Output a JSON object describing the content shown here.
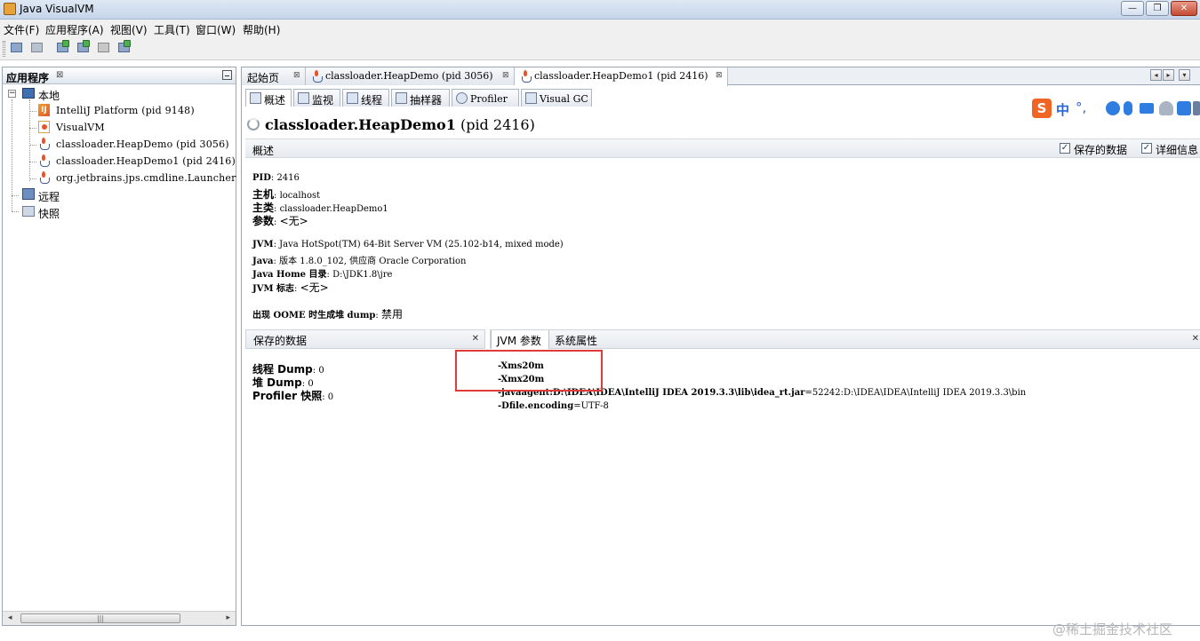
{
  "window": {
    "title": "Java VisualVM",
    "min_glyph": "—",
    "max_glyph": "❐",
    "close_glyph": "✕"
  },
  "menu": [
    "文件(F)",
    "应用程序(A)",
    "视图(V)",
    "工具(T)",
    "窗口(W)",
    "帮助(H)"
  ],
  "left_panel": {
    "title": "应用程序",
    "close_glyph": "⊠",
    "tree": {
      "local": "本地",
      "local_children": [
        "IntelliJ Platform (pid 9148)",
        "VisualVM",
        "classloader.HeapDemo (pid 3056)",
        "classloader.HeapDemo1 (pid 2416)",
        "org.jetbrains.jps.cmdline.Launcher"
      ],
      "remote": "远程",
      "snapshots": "快照"
    },
    "scroll_arrow_left": "◂",
    "scroll_arrow_right": "▸",
    "scroll_grip": "|||"
  },
  "doc_tabs": [
    {
      "label": "起始页"
    },
    {
      "label": "classloader.HeapDemo (pid 3056)"
    },
    {
      "label": "classloader.HeapDemo1 (pid 2416)"
    }
  ],
  "doc_tab_close_glyph": "⊠",
  "doc_nav": {
    "left": "◂",
    "right": "▸",
    "menu": "▾",
    "restore": "▭"
  },
  "sub_tabs": [
    "概述",
    "监视",
    "线程",
    "抽样器",
    "Profiler",
    "Visual GC"
  ],
  "app_title": {
    "name": "classloader.HeapDemo1",
    "pid": "(pid 2416)"
  },
  "overview": {
    "section_title": "概述",
    "checkbox_saved": {
      "label": "保存的数据",
      "checked": true,
      "glyph": "✓"
    },
    "checkbox_details": {
      "label": "详细信息",
      "checked": true,
      "glyph": "✓"
    },
    "pid_key": "PID",
    "pid_value": "2416",
    "host_key": "主机",
    "host_value": "localhost",
    "mainclass_key": "主类",
    "mainclass_value": "classloader.HeapDemo1",
    "args_key": "参数",
    "args_value": "<无>",
    "jvm_key": "JVM",
    "jvm_value": "Java HotSpot(TM) 64-Bit Server VM (25.102-b14, mixed mode)",
    "java_key": "Java",
    "java_value": "版本 1.8.0_102, 供应商 Oracle Corporation",
    "javahome_key": "Java Home 目录",
    "javahome_value": "D:\\JDK1.8\\jre",
    "jvmflags_key": "JVM 标志",
    "jvmflags_value": "<无>",
    "oome_key": "出现 OOME 时生成堆 dump",
    "oome_value": "禁用",
    "sep": ": "
  },
  "saved_data": {
    "title": "保存的数据",
    "close_glyph": "✕",
    "thread_dump_key": "线程 Dump",
    "thread_dump_value": "0",
    "heap_dump_key": "堆 Dump",
    "heap_dump_value": "0",
    "profiler_key": "Profiler 快照",
    "profiler_value": "0"
  },
  "jvm_tabs": {
    "active": "JVM 参数",
    "other": "系统属性",
    "close_glyph": "✕"
  },
  "jvm_args": {
    "xms": "-Xms20m",
    "xmx": "-Xmx20m",
    "javaagent_key": "-javaagent:D:\\IDEA\\IDEA\\IntelliJ IDEA 2019.3.3\\lib\\idea_rt.jar",
    "javaagent_val": "=52242:D:\\IDEA\\IDEA\\IntelliJ IDEA 2019.3.3\\bin",
    "encoding_key": "-Dfile.encoding",
    "encoding_val": "=UTF-8"
  },
  "ime": {
    "logo": "S",
    "mode": "中",
    "punct": "°,",
    "icons": [
      "emoji-icon",
      "microphone-icon",
      "keyboard-icon",
      "user-icon",
      "shirt-icon",
      "tools-icon"
    ]
  },
  "watermark": "@稀土掘金技术社区",
  "colors": {
    "highlight": "#e03a3a",
    "ime_accent": "#f06424"
  }
}
